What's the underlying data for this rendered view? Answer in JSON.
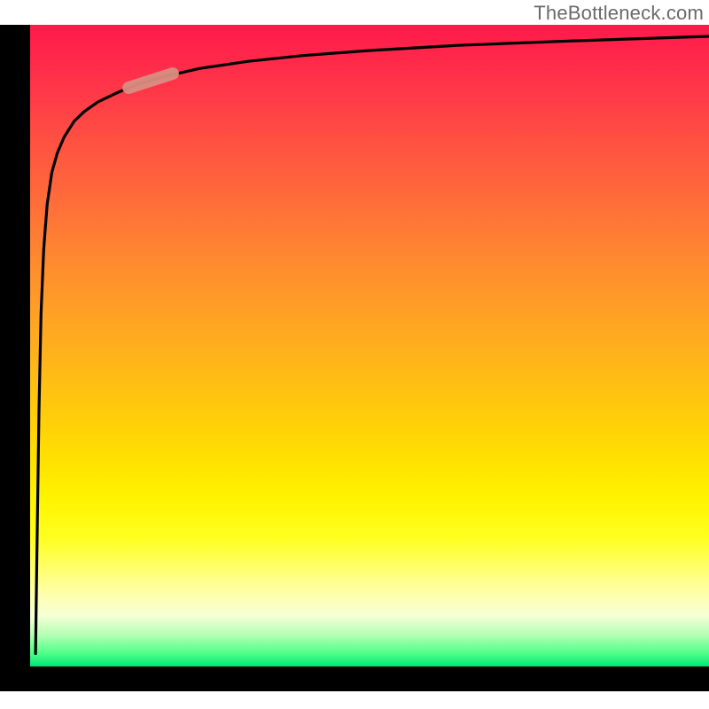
{
  "attribution": "TheBottleneck.com",
  "colors": {
    "axis": "#000000",
    "highlight": "#d98d82",
    "gradient_top": "#ff1a4b",
    "gradient_mid": "#ffe100",
    "gradient_bottom": "#00e676"
  },
  "chart_data": {
    "type": "line",
    "title": "",
    "xlabel": "",
    "ylabel": "",
    "xlim": [
      0,
      100
    ],
    "ylim": [
      0,
      100
    ],
    "series": [
      {
        "name": "bottleneck-curve",
        "x": [
          0.8,
          1.0,
          1.3,
          1.6,
          2.0,
          2.5,
          3.2,
          4.0,
          5.0,
          6.5,
          8.0,
          10.0,
          13.0,
          16.0,
          20.0,
          25.0,
          32.0,
          40.0,
          50.0,
          63.0,
          80.0,
          100.0
        ],
        "y": [
          2,
          18,
          40,
          55,
          65,
          72,
          77,
          80,
          82.5,
          85,
          86.5,
          88,
          89.5,
          90.8,
          92,
          93.2,
          94.3,
          95.2,
          96.0,
          96.8,
          97.5,
          98.2
        ]
      }
    ],
    "annotations": [
      {
        "name": "highlight-segment",
        "x_range": [
          14.5,
          21.0
        ],
        "y_range": [
          90.2,
          92.4
        ],
        "style": "thick-rounded-rose"
      }
    ],
    "background": {
      "type": "vertical-gradient",
      "stops": [
        {
          "pos": 0.0,
          "color": "#ff1a4b"
        },
        {
          "pos": 0.5,
          "color": "#ffb41a"
        },
        {
          "pos": 0.8,
          "color": "#ffff20"
        },
        {
          "pos": 1.0,
          "color": "#00e676"
        }
      ]
    }
  }
}
